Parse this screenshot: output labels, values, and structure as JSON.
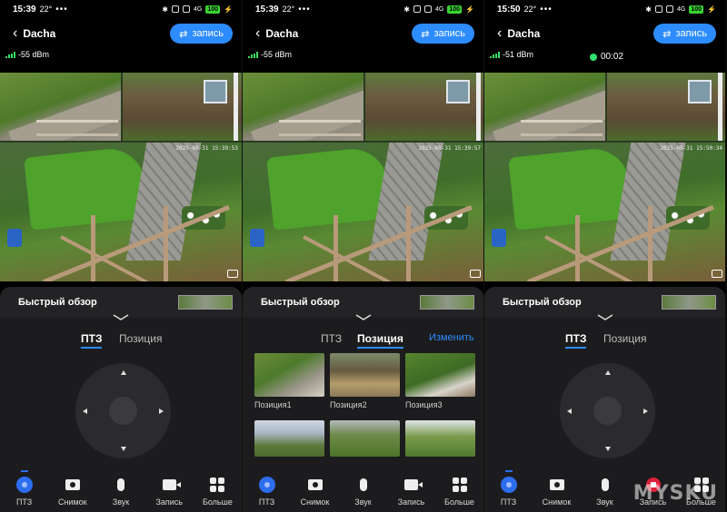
{
  "screens": [
    {
      "status": {
        "time": "15:39",
        "temp": "22°",
        "dots": "•••",
        "net": "4G",
        "battery": "100"
      },
      "header": {
        "back": "‹",
        "title": "Dacha",
        "record_label": "запись"
      },
      "signal": "-55 dBm",
      "timestamp": "2025-08-31 15:39:53",
      "panel": {
        "title": "Быстрый обзор",
        "tabs": [
          "ПТЗ",
          "Позиция"
        ],
        "active_tab": "ПТЗ"
      },
      "nav": [
        "ПТЗ",
        "Снимок",
        "Звук",
        "Запись",
        "Больше"
      ]
    },
    {
      "status": {
        "time": "15:39",
        "temp": "22°",
        "dots": "•••",
        "net": "4G",
        "battery": "100"
      },
      "header": {
        "back": "‹",
        "title": "Dacha",
        "record_label": "запись"
      },
      "signal": "-55 dBm",
      "timestamp": "2025-08-31 15:39:57",
      "panel": {
        "title": "Быстрый обзор",
        "tabs": [
          "ПТЗ",
          "Позиция"
        ],
        "active_tab": "Позиция",
        "edit_label": "Изменить"
      },
      "positions": [
        "Позиция1",
        "Позиция2",
        "Позиция3"
      ],
      "nav": [
        "ПТЗ",
        "Снимок",
        "Звук",
        "Запись",
        "Больше"
      ]
    },
    {
      "status": {
        "time": "15:50",
        "temp": "22°",
        "dots": "•••",
        "net": "4G",
        "battery": "100"
      },
      "header": {
        "back": "‹",
        "title": "Dacha",
        "record_label": "запись"
      },
      "signal": "-51 dBm",
      "recording_timer": "00:02",
      "timestamp": "2025-08-31 15:50:34",
      "panel": {
        "title": "Быстрый обзор",
        "tabs": [
          "ПТЗ",
          "Позиция"
        ],
        "active_tab": "ПТЗ"
      },
      "nav": [
        "ПТЗ",
        "Снимок",
        "Звук",
        "Запись",
        "Больше"
      ]
    }
  ],
  "watermark": "MYSKU",
  "colors": {
    "accent": "#2d8cff",
    "record_dot": "#32e06e",
    "record_active": "#e0203a",
    "battery": "#38d430"
  }
}
